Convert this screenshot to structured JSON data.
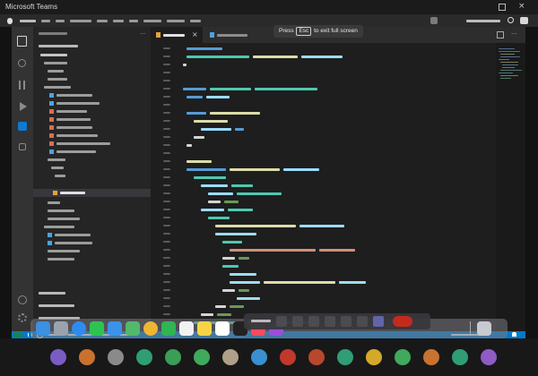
{
  "window": {
    "app_title": "Microsoft Teams",
    "notice": {
      "before": "Press",
      "key": "Esc",
      "after": "to exit full screen"
    }
  },
  "colors": {
    "status_bar": "#007acc",
    "keyword": "#569cd6",
    "type": "#4ec9b0",
    "function": "#dcdcaa",
    "string": "#ce9178",
    "comment": "#6a9955",
    "hangup": "#c42b1c"
  },
  "icons": {
    "activity_bar": [
      "explorer-icon",
      "search-icon",
      "source-control-icon",
      "run-debug-icon",
      "extensions-icon",
      "remote-icon",
      "account-icon",
      "settings-gear-icon"
    ],
    "call_controls": [
      "camera-icon",
      "microphone-icon",
      "share-screen-icon",
      "more-icon",
      "raise-hand-icon",
      "chat-icon",
      "people-icon",
      "hang-up-icon"
    ]
  }
}
